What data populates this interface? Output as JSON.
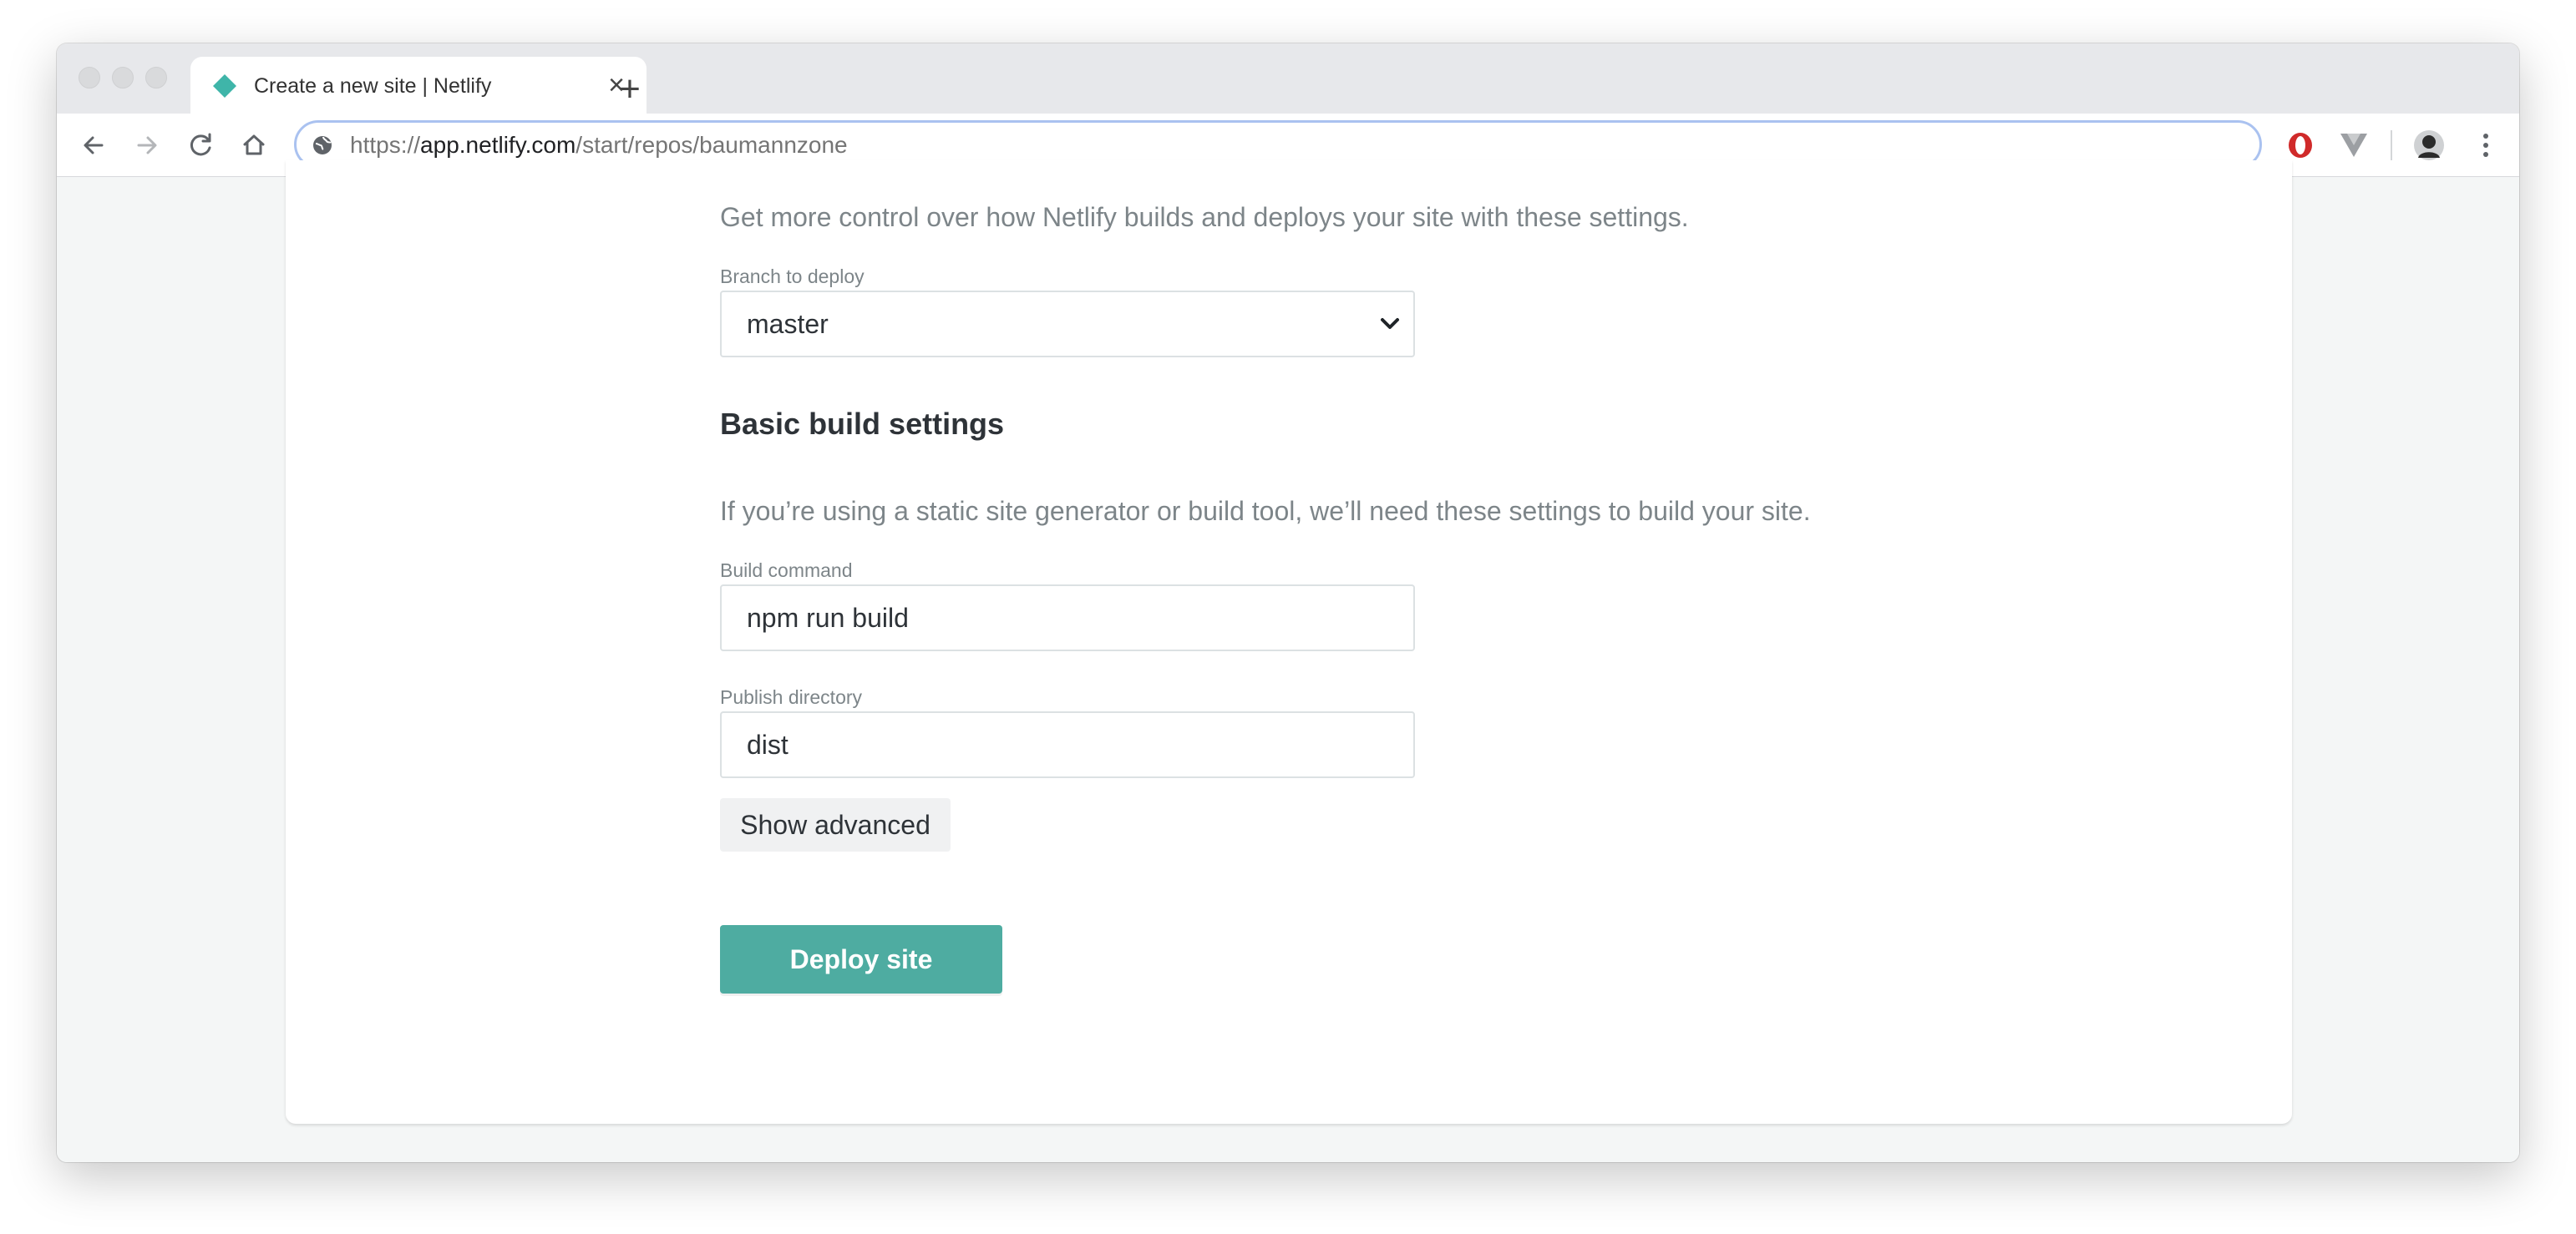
{
  "browser": {
    "tab_title": "Create a new site | Netlify",
    "tab_close_glyph": "×",
    "new_tab_glyph": "+",
    "url": {
      "prefix": "https://",
      "host": "app.netlify.com",
      "path": "/start/repos/baumannzone"
    },
    "icons": [
      "netlify-favicon",
      "back-arrow-icon",
      "forward-arrow-icon",
      "reload-icon",
      "home-icon",
      "site-info-icon",
      "opera-extension-icon",
      "vue-devtools-icon",
      "profile-avatar-icon",
      "menu-dots-icon"
    ]
  },
  "page": {
    "deploy_settings_description": "Get more control over how Netlify builds and deploys your site with these settings.",
    "branch": {
      "label": "Branch to deploy",
      "selected": "master"
    },
    "build_section": {
      "heading": "Basic build settings",
      "description": "If you’re using a static site generator or build tool, we’ll need these settings to build your site."
    },
    "build_command": {
      "label": "Build command",
      "value": "npm run build"
    },
    "publish_directory": {
      "label": "Publish directory",
      "value": "dist"
    },
    "show_advanced_label": "Show advanced",
    "deploy_label": "Deploy site"
  },
  "colors": {
    "accent": "#4eaca1",
    "text": "#2e3338",
    "muted": "#7d8589",
    "page_bg": "#f4f6f6"
  }
}
